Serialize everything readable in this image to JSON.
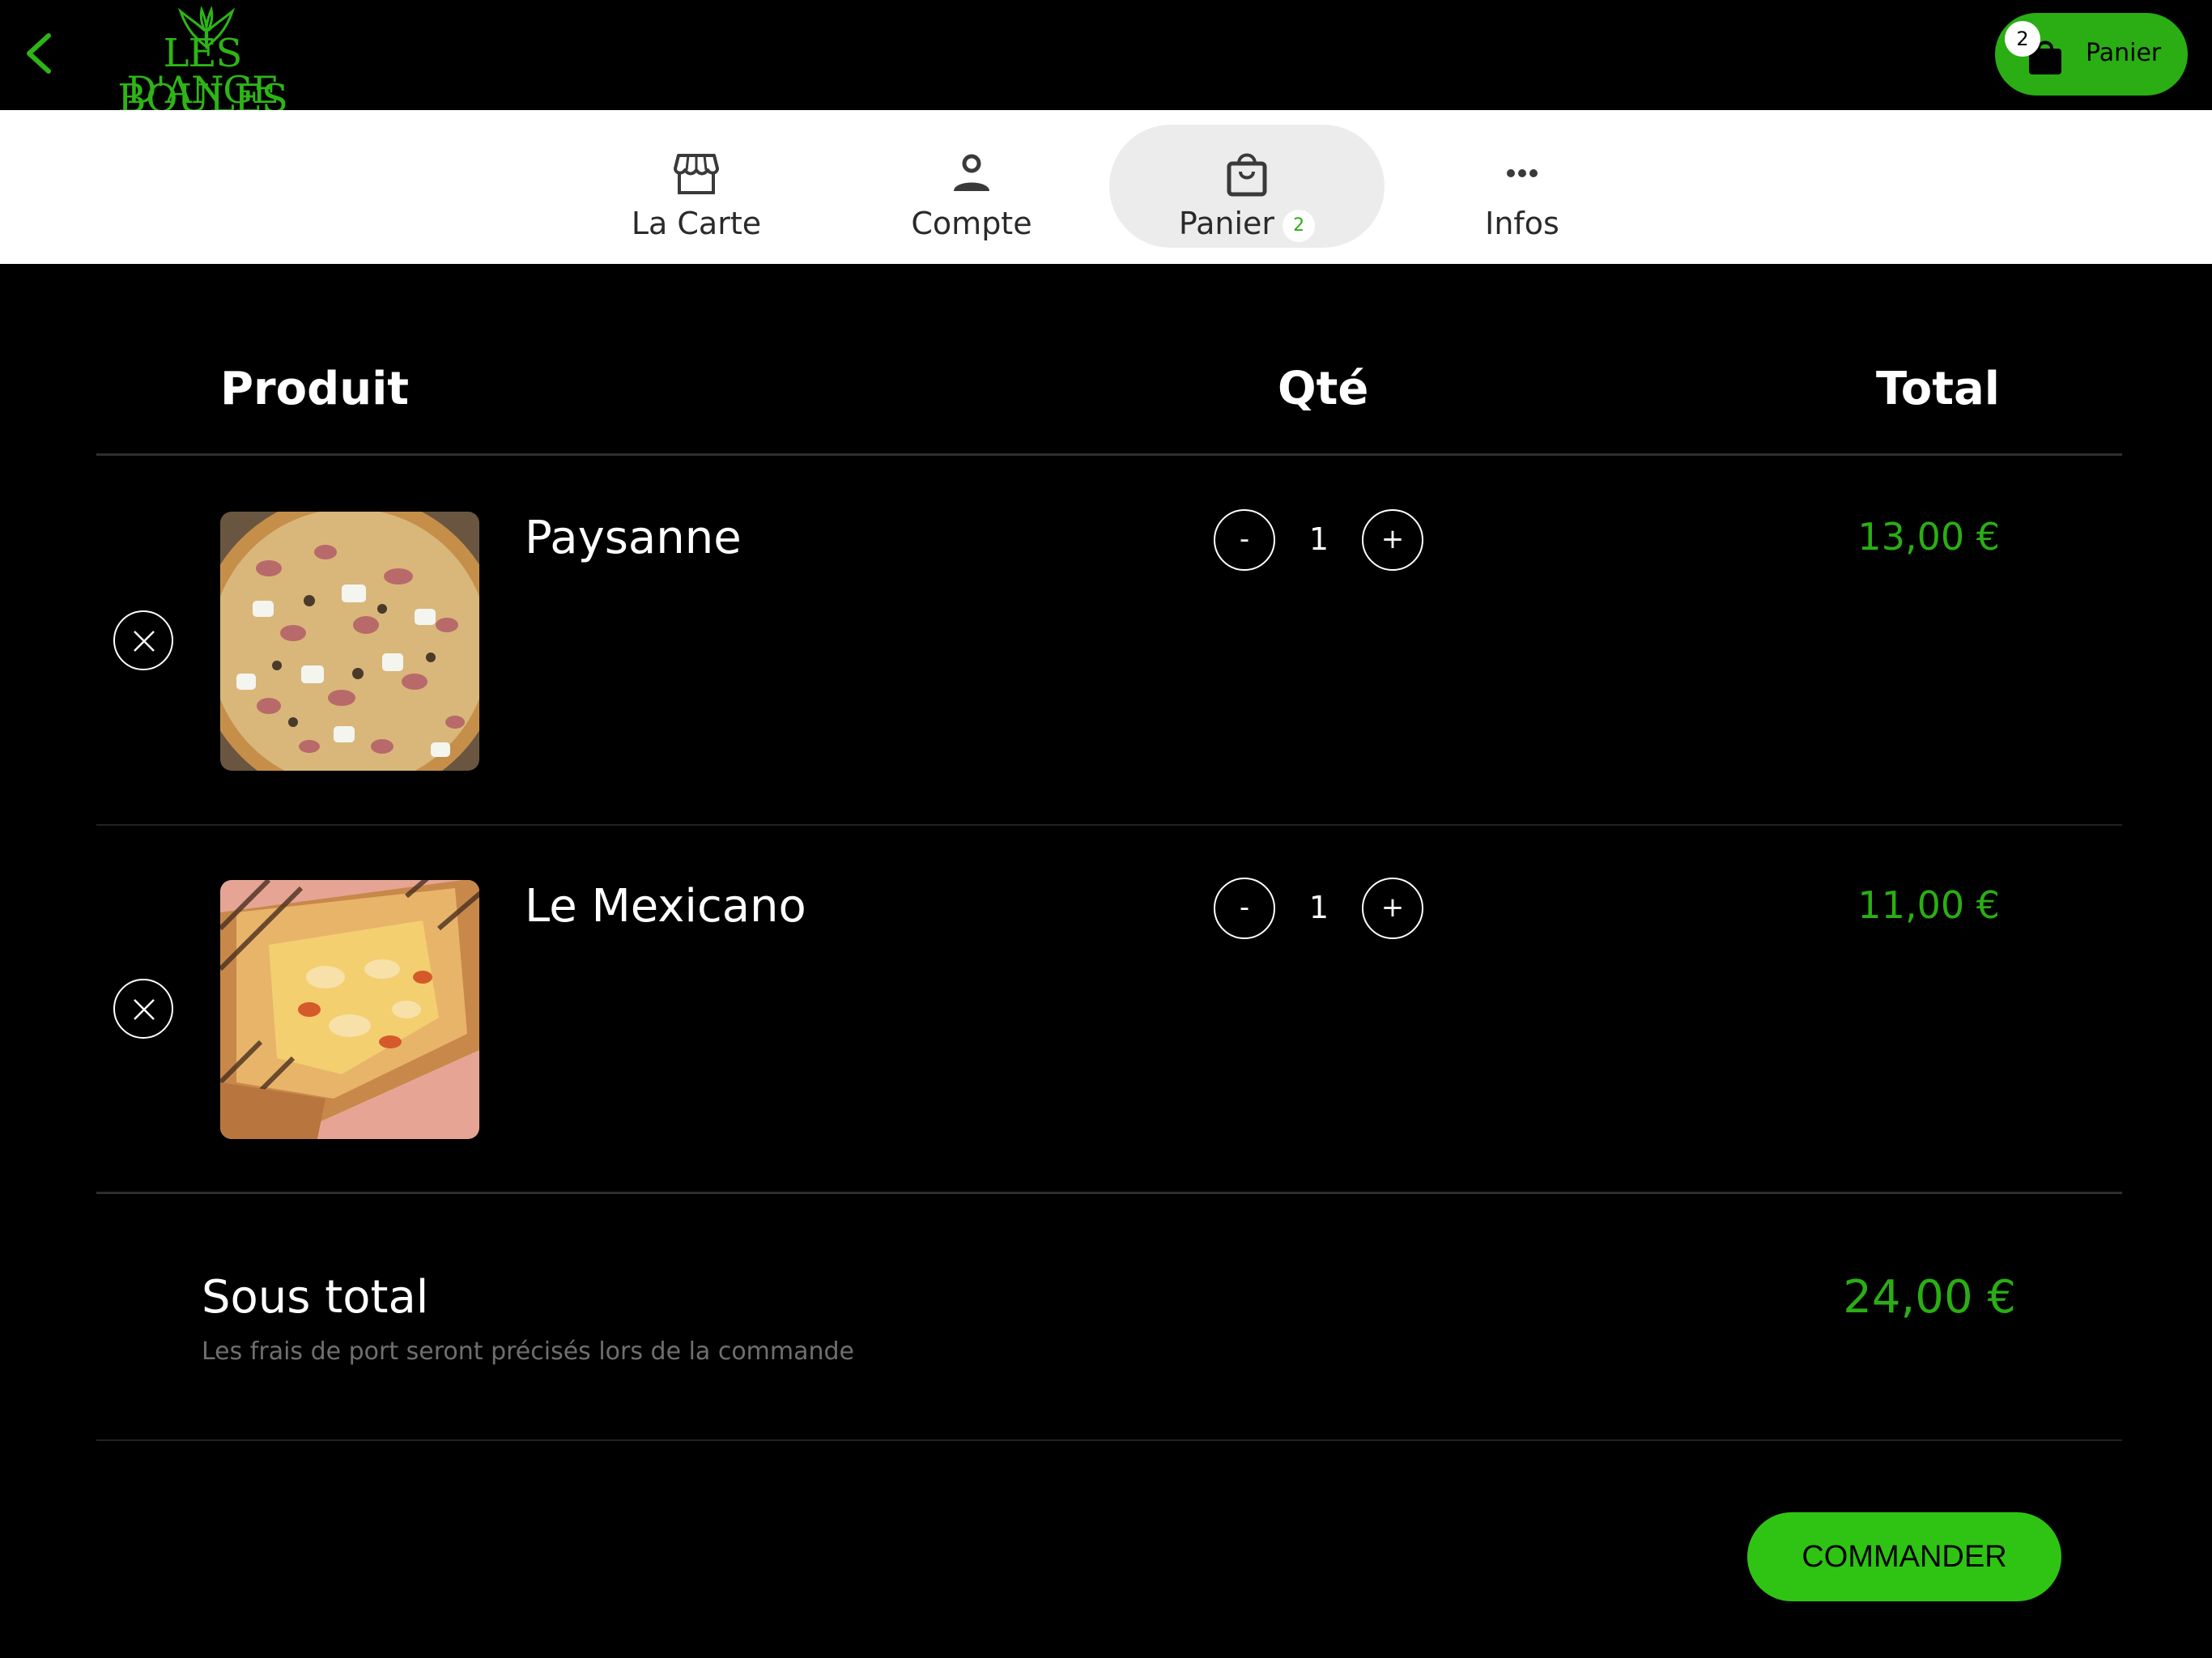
{
  "header": {
    "logo_line1": "LES BOULES",
    "logo_line2": "D'ANGE",
    "cart_button_label": "Panier",
    "cart_count": "2"
  },
  "nav": {
    "tabs": [
      {
        "label": "La Carte",
        "icon": "store-icon"
      },
      {
        "label": "Compte",
        "icon": "user-icon"
      },
      {
        "label": "Panier",
        "icon": "bag-icon",
        "badge": "2",
        "active": true
      },
      {
        "label": "Infos",
        "icon": "more-icon"
      }
    ]
  },
  "cart": {
    "columns": {
      "product": "Produit",
      "qty": "Qté",
      "total": "Total"
    },
    "items": [
      {
        "name": "Paysanne",
        "qty": "1",
        "price": "13,00 €",
        "image": "pizza"
      },
      {
        "name": "Le Mexicano",
        "qty": "1",
        "price": "11,00 €",
        "image": "wrap"
      }
    ],
    "minus_label": "-",
    "plus_label": "+",
    "subtotal_label": "Sous total",
    "subtotal_value": "24,00 €",
    "shipping_note": "Les frais de port seront précisés lors de la commande",
    "order_button": "COMMANDER"
  },
  "colors": {
    "accent": "#2aae14",
    "background": "#000000",
    "nav_background": "#ffffff",
    "active_tab": "#ececec"
  }
}
